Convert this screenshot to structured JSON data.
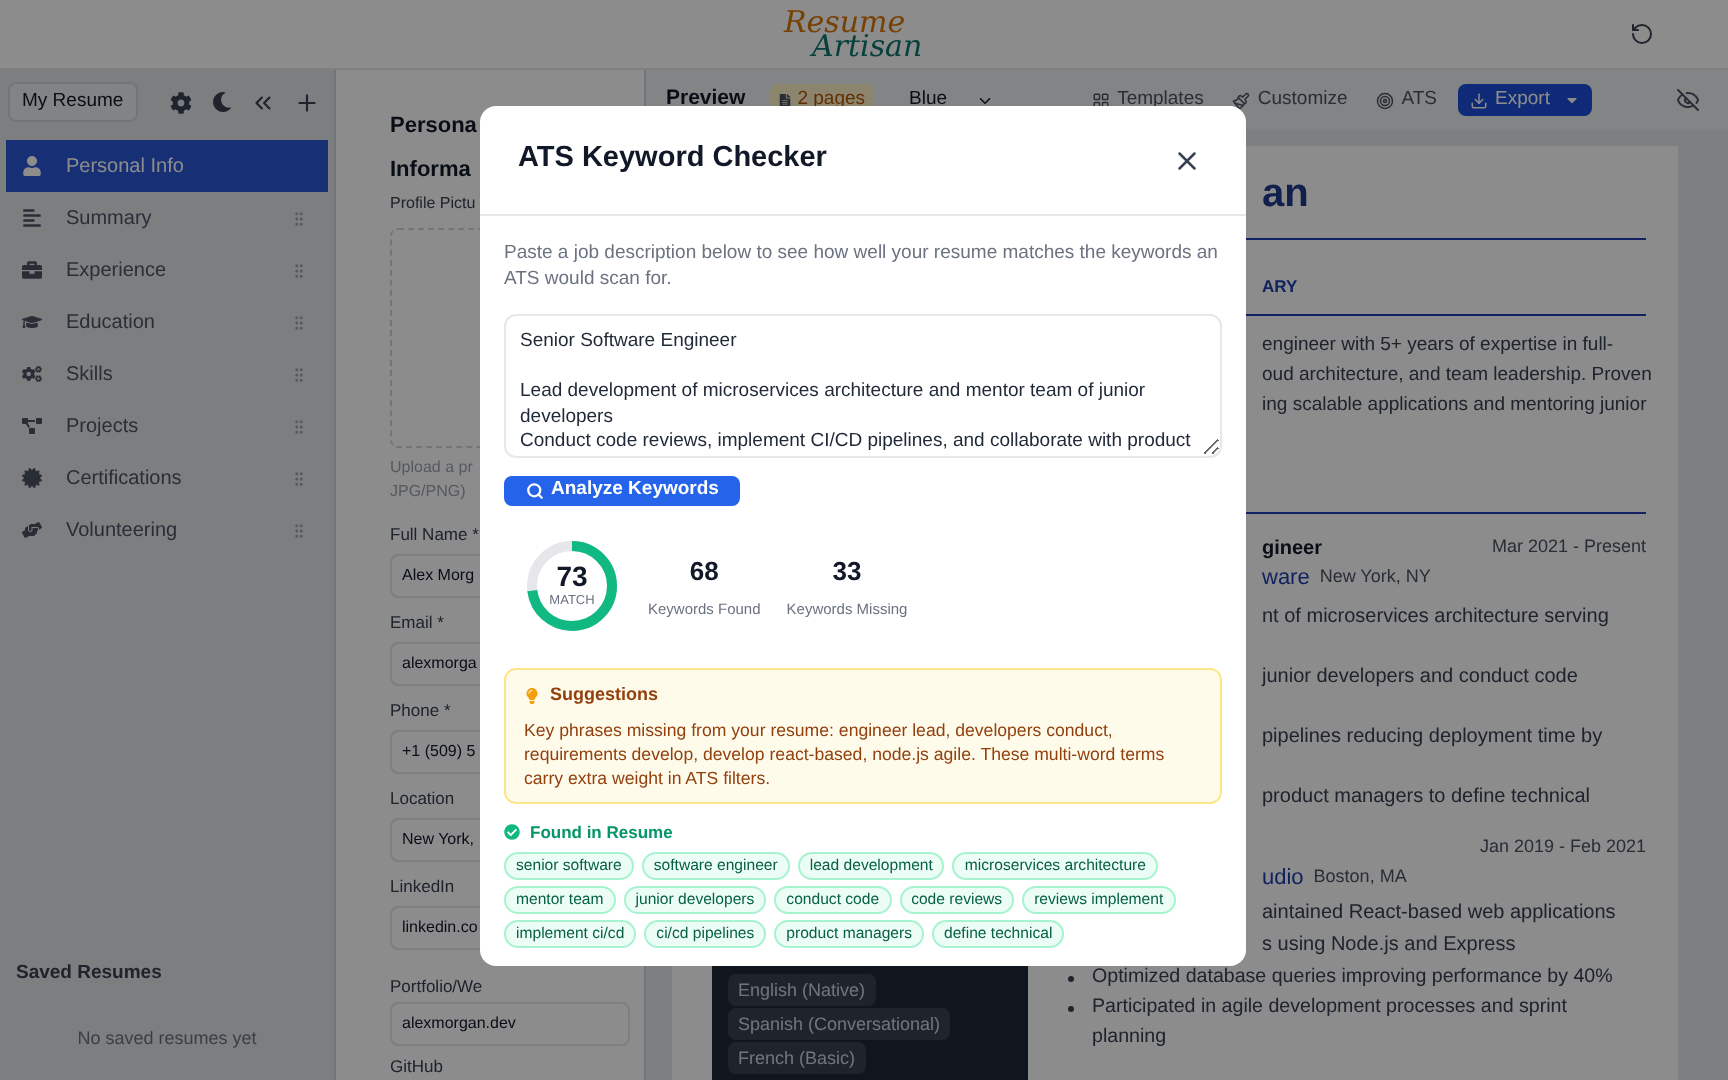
{
  "header": {
    "logo_top": "Resume",
    "logo_bottom": "Artisan"
  },
  "sidebar": {
    "resume_button": "My Resume",
    "items": [
      {
        "label": "Personal Info",
        "selected": true
      },
      {
        "label": "Summary",
        "selected": false
      },
      {
        "label": "Experience",
        "selected": false
      },
      {
        "label": "Education",
        "selected": false
      },
      {
        "label": "Skills",
        "selected": false
      },
      {
        "label": "Projects",
        "selected": false
      },
      {
        "label": "Certifications",
        "selected": false
      },
      {
        "label": "Volunteering",
        "selected": false
      }
    ],
    "saved_title": "Saved Resumes",
    "saved_empty": "No saved resumes yet"
  },
  "form": {
    "title_lines": [
      "Persona",
      "Informa"
    ],
    "profile_label": "Profile Pictu",
    "upload_hint_lines": [
      "Upload a pr",
      "JPG/PNG)"
    ],
    "fields": [
      {
        "label": "Full Name *",
        "value": "Alex Morg"
      },
      {
        "label": "Email *",
        "value": "alexmorga"
      },
      {
        "label": "Phone *",
        "value": "+1 (509) 5"
      },
      {
        "label": "Location",
        "value": "New York,"
      },
      {
        "label": "LinkedIn",
        "value": "linkedin.co"
      },
      {
        "label": "Portfolio/We",
        "value": "alexmorgan.dev"
      }
    ],
    "last_label": "GitHub"
  },
  "preview": {
    "toolbar": {
      "title": "Preview",
      "pages": "2 pages",
      "scheme": "Blue",
      "actions": [
        "Templates",
        "Customize",
        "ATS"
      ],
      "export": "Export"
    },
    "resume": {
      "name": "an",
      "summary_heading": "ARY",
      "summary_lines": [
        "engineer with 5+ years of expertise in full-",
        "oud architecture, and team leadership. Proven",
        "ing scalable applications and mentoring junior"
      ],
      "languages": [
        "English (Native)",
        "Spanish (Conversational)",
        "French (Basic)"
      ],
      "jobs": [
        {
          "title": "gineer",
          "dates": "Mar 2021 - Present",
          "company": "ware",
          "location": "New York, NY",
          "cut_lines": [
            "nt of microservices architecture serving",
            "junior developers and conduct code",
            "pipelines reducing deployment time by",
            "product managers to define technical"
          ]
        },
        {
          "dates": "Jan 2019 - Feb 2021",
          "company": "udio",
          "location": "Boston, MA",
          "cut_lines": [
            "aintained React-based web applications",
            "s using Node.js and Express"
          ],
          "bullets": [
            "Optimized database queries improving performance by 40%",
            "Participated in agile development processes and sprint planning"
          ]
        }
      ]
    }
  },
  "modal": {
    "title": "ATS Keyword Checker",
    "description": "Paste a job description below to see how well your resume matches the keywords an ATS would scan for.",
    "job_description": "Senior Software Engineer\n\nLead development of microservices architecture and mentor team of junior developers\nConduct code reviews, implement CI/CD pipelines, and collaborate with product",
    "analyze_button": "Analyze Keywords",
    "score": {
      "value": "73",
      "label": "MATCH",
      "level": 0.73
    },
    "stats": [
      {
        "value": "68",
        "label": "Keywords Found"
      },
      {
        "value": "33",
        "label": "Keywords Missing"
      }
    ],
    "suggestions": {
      "title": "Suggestions",
      "text": "Key phrases missing from your resume: engineer lead, developers conduct, requirements develop, develop react-based, node.js agile. These multi-word terms carry extra weight in ATS filters."
    },
    "found": {
      "title": "Found in Resume",
      "keywords": [
        "senior software",
        "software engineer",
        "lead development",
        "microservices architecture",
        "mentor team",
        "junior developers",
        "conduct code",
        "code reviews",
        "reviews implement",
        "implement ci/cd",
        "ci/cd pipelines",
        "product managers",
        "define technical"
      ]
    }
  }
}
